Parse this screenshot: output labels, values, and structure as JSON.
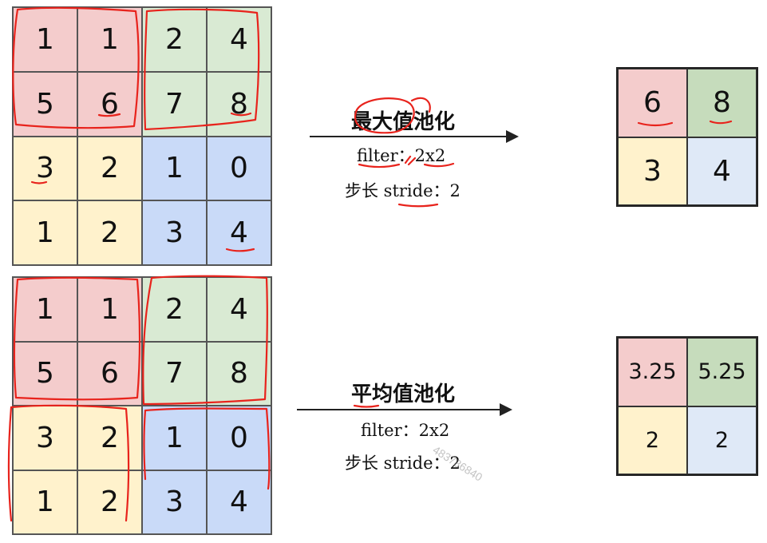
{
  "max_pool": {
    "title": "最大值池化",
    "filter_text": "filter：2x2",
    "stride_text": "步长 stride：2",
    "input_grid": [
      [
        "1",
        "1",
        "2",
        "4"
      ],
      [
        "5",
        "6",
        "7",
        "8"
      ],
      [
        "3",
        "2",
        "1",
        "0"
      ],
      [
        "1",
        "2",
        "3",
        "4"
      ]
    ],
    "output_grid": [
      [
        "6",
        "8"
      ],
      [
        "3",
        "4"
      ]
    ]
  },
  "avg_pool": {
    "title": "平均值池化",
    "filter_text": "filter：2x2",
    "stride_text": "步长 stride：2",
    "input_grid": [
      [
        "1",
        "1",
        "2",
        "4"
      ],
      [
        "5",
        "6",
        "7",
        "8"
      ],
      [
        "3",
        "2",
        "1",
        "0"
      ],
      [
        "1",
        "2",
        "3",
        "4"
      ]
    ],
    "output_grid": [
      [
        "3.25",
        "5.25"
      ],
      [
        "2",
        "2"
      ]
    ]
  },
  "quadrant_colors": {
    "top_left": "#f4cccc",
    "top_right": "#d9ead3",
    "bottom_left": "#fff2cc",
    "bottom_right": "#c9daf8"
  },
  "annotation_color": "#e8231c",
  "watermark": "483786840"
}
